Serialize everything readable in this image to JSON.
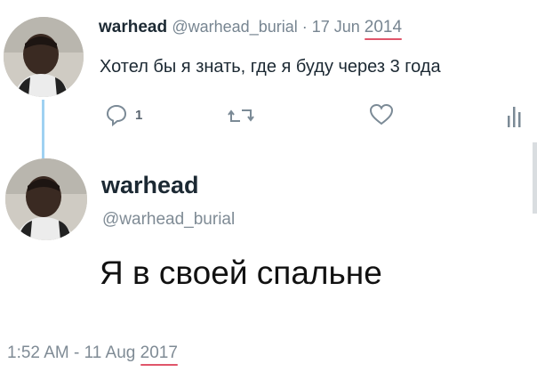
{
  "tweet1": {
    "name": "warhead",
    "handle": "@warhead_burial",
    "separator": " · ",
    "date": "17 Jun ",
    "year": "2014",
    "text": "Хотел бы я знать, где я буду через 3 года",
    "reply_count": "1",
    "icons": [
      "reply-icon",
      "retweet-icon",
      "like-icon",
      "analytics-icon"
    ]
  },
  "tweet2": {
    "name": "warhead",
    "handle": "@warhead_burial",
    "text": "Я в своей спальне",
    "timestamp": "1:52 AM - 11 Aug ",
    "year": "2017"
  },
  "colors": {
    "thread_line": "#9fd1f2",
    "underline": "#e0556a",
    "muted": "#7f8b95"
  }
}
